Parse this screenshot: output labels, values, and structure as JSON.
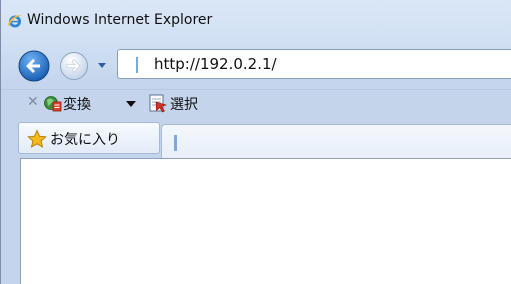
{
  "window": {
    "title": "Windows Internet Explorer"
  },
  "navigation": {
    "back_icon": "back-arrow-icon",
    "forward_icon": "forward-arrow-icon",
    "address": "http://192.0.2.1/"
  },
  "command_bar": {
    "convert_label": "変換",
    "select_label": "選択"
  },
  "favorites": {
    "label": "お気に入り"
  },
  "colors": {
    "chrome_bg": "#d2e1f4",
    "back_button": "#1a5fb4",
    "accent_caret": "#7aa9e0",
    "star": "#f4b81e"
  }
}
